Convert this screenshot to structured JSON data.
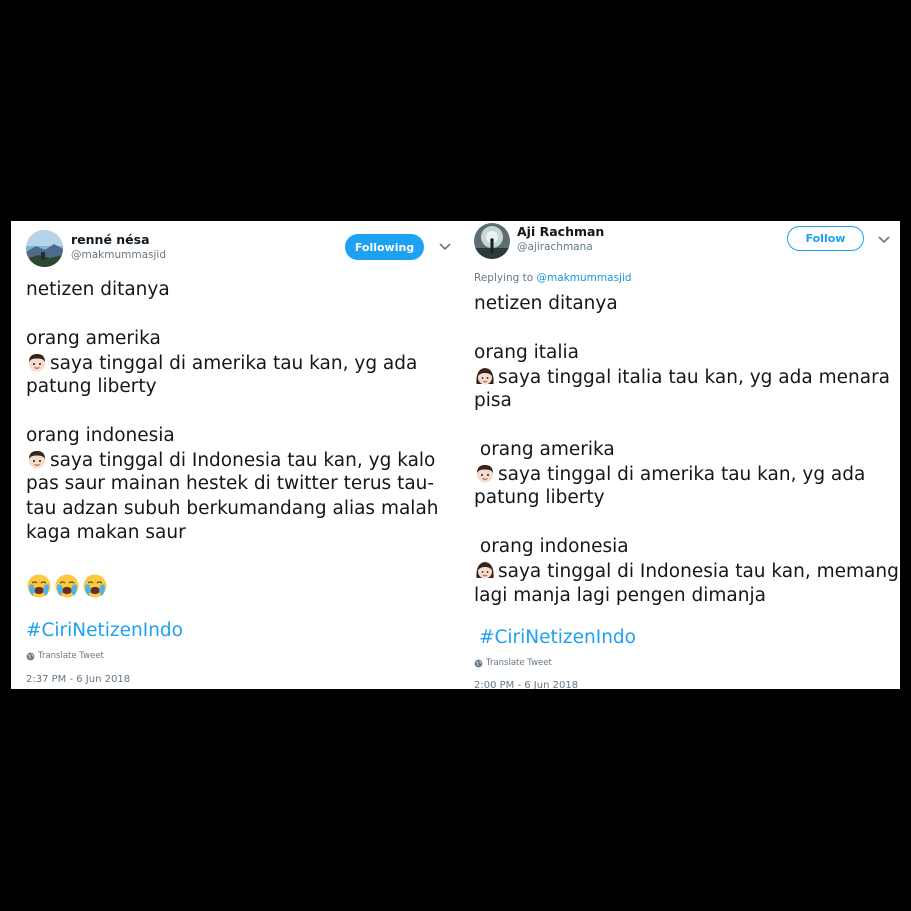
{
  "left_tweet": {
    "author_name": "renné nésa",
    "author_handle": "@makmummasjid",
    "follow_button_label": "Following",
    "lines": [
      "netizen ditanya",
      "",
      "orang amerika",
      "saya tinggal di amerika tau kan, yg ada",
      "patung liberty",
      "",
      "orang indonesia",
      "saya tinggal di Indonesia tau kan, yg kalo",
      "pas saur mainan hestek di twitter terus tau-",
      "tau adzan subuh berkumandang alias malah",
      "kaga makan saur"
    ],
    "hashtag": "#CiriNetizenIndo",
    "translate_label": "Translate Tweet",
    "timestamp": "2:37 PM - 6 Jun 2018"
  },
  "right_tweet": {
    "author_name": "Aji Rachman",
    "author_handle": "@ajirachmana",
    "follow_button_label": "Follow",
    "replying_label": "Replying to",
    "replying_handle": "@makmummasjid",
    "lines": [
      "netizen ditanya",
      "",
      "orang italia",
      "saya tinggal italia tau kan, yg ada menara",
      "pisa",
      "",
      " orang amerika",
      "saya tinggal di amerika tau kan, yg ada",
      "patung liberty",
      "",
      " orang indonesia",
      "saya tinggal di Indonesia tau kan, memang",
      "lagi manja lagi pengen dimanja"
    ],
    "hashtag": "#CiriNetizenIndo",
    "translate_label": "Translate Tweet",
    "timestamp": "2:00 PM - 6 Jun 2018"
  },
  "icons": {
    "emoji": [
      "boy-emoji",
      "girl-emoji",
      "loudly-crying-face-emoji"
    ],
    "ui": [
      "chevron-down-icon",
      "globe-icon"
    ]
  },
  "colors": {
    "twitter_blue": "#1da1f2",
    "text": "#14171a",
    "muted": "#657786"
  }
}
